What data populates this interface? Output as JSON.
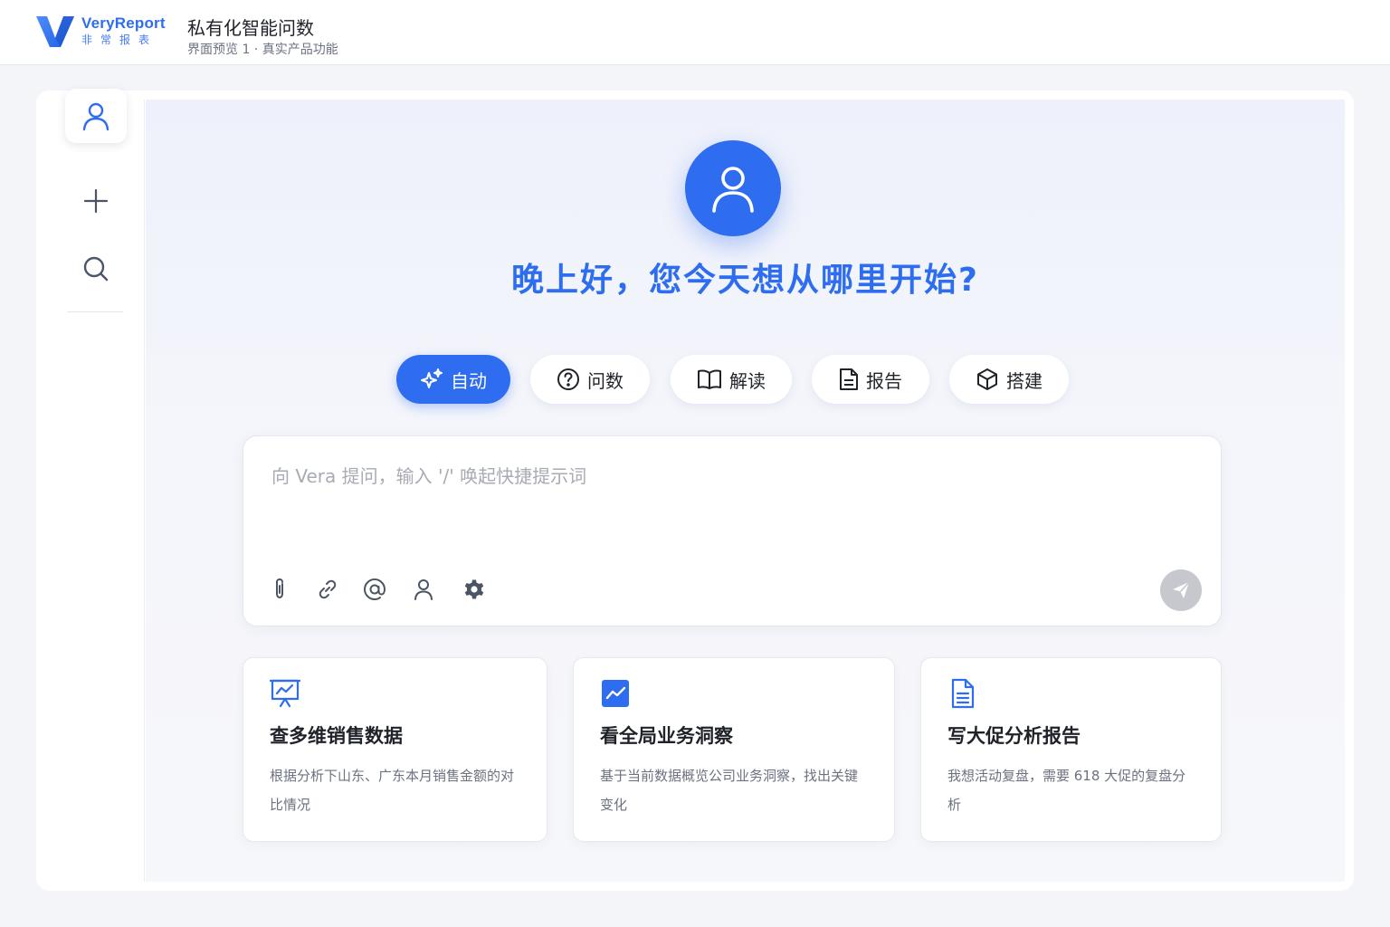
{
  "brand": {
    "name": "VeryReport",
    "sub": "非常报表"
  },
  "header": {
    "title": "私有化智能问数",
    "subtitle": "界面预览 1 · 真实产品功能"
  },
  "sidebar": {
    "items": [
      {
        "icon": "user-icon",
        "active": true
      },
      {
        "icon": "plus-icon",
        "active": false
      },
      {
        "icon": "search-icon",
        "active": false
      }
    ]
  },
  "greeting": "晚上好，您今天想从哪里开始?",
  "modes": [
    {
      "label": "自动",
      "icon": "sparkle-icon",
      "active": true
    },
    {
      "label": "问数",
      "icon": "question-circle-icon",
      "active": false
    },
    {
      "label": "解读",
      "icon": "book-icon",
      "active": false
    },
    {
      "label": "报告",
      "icon": "document-icon",
      "active": false
    },
    {
      "label": "搭建",
      "icon": "cube-icon",
      "active": false
    }
  ],
  "composer": {
    "placeholder": "向 Vera 提问，输入 '/' 唤起快捷提示词",
    "value": "",
    "tools": [
      "attachment-icon",
      "link-icon",
      "at-icon",
      "user-icon",
      "settings-icon"
    ],
    "send_icon": "send-icon"
  },
  "cards": [
    {
      "icon": "presentation-chart-icon",
      "title": "查多维销售数据",
      "desc": "根据分析下山东、广东本月销售金额的对比情况"
    },
    {
      "icon": "trend-chart-icon",
      "title": "看全局业务洞察",
      "desc": "基于当前数据概览公司业务洞察，找出关键变化"
    },
    {
      "icon": "report-document-icon",
      "title": "写大促分析报告",
      "desc": "我想活动复盘，需要 618 大促的复盘分析"
    }
  ],
  "colors": {
    "accent": "#2f6df0",
    "background": "#f3f5f9",
    "send_disabled": "#c6c8cd"
  }
}
